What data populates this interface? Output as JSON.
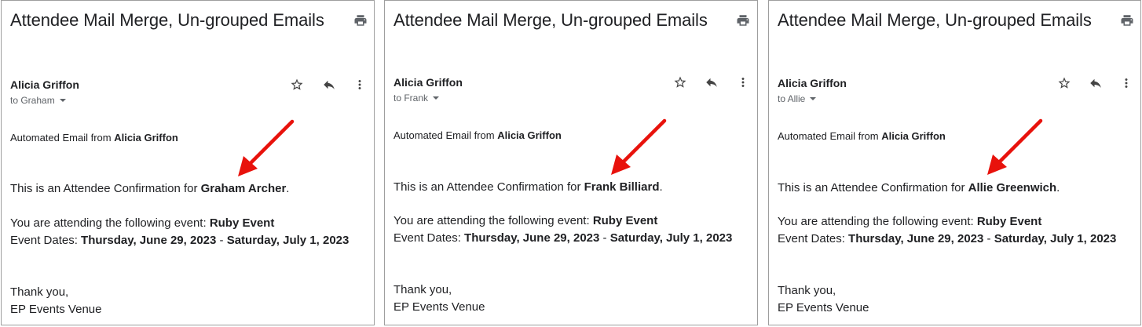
{
  "emails": [
    {
      "subject": "Attendee Mail Merge, Un-grouped Emails",
      "sender": "Alicia Griffon",
      "recipient": "to Graham",
      "automated_prefix": "Automated Email from ",
      "automated_name": "Alicia Griffon",
      "confirmation_prefix": "This is an Attendee Confirmation for ",
      "attendee_name": "Graham Archer",
      "confirmation_suffix": ".",
      "event_prefix": "You are attending the following event: ",
      "event_name": "Ruby Event",
      "dates_prefix": "Event Dates: ",
      "date_start": "Thursday, June 29, 2023",
      "date_sep": " - ",
      "date_end": "Saturday, July 1, 2023",
      "thanks": "Thank you,",
      "venue": "EP Events Venue"
    },
    {
      "subject": "Attendee Mail Merge, Un-grouped Emails",
      "sender": "Alicia Griffon",
      "recipient": "to Frank",
      "automated_prefix": "Automated Email from ",
      "automated_name": "Alicia Griffon",
      "confirmation_prefix": "This is an Attendee Confirmation for ",
      "attendee_name": "Frank Billiard",
      "confirmation_suffix": ".",
      "event_prefix": "You are attending the following event: ",
      "event_name": "Ruby Event",
      "dates_prefix": "Event Dates: ",
      "date_start": "Thursday, June 29, 2023",
      "date_sep": " - ",
      "date_end": "Saturday, July 1, 2023",
      "thanks": "Thank you,",
      "venue": "EP Events Venue"
    },
    {
      "subject": "Attendee Mail Merge, Un-grouped Emails",
      "sender": "Alicia Griffon",
      "recipient": "to Allie",
      "automated_prefix": "Automated Email from ",
      "automated_name": "Alicia Griffon",
      "confirmation_prefix": "This is an Attendee Confirmation for ",
      "attendee_name": "Allie Greenwich",
      "confirmation_suffix": ".",
      "event_prefix": "You are attending the following event: ",
      "event_name": "Ruby Event",
      "dates_prefix": "Event Dates: ",
      "date_start": "Thursday, June 29, 2023",
      "date_sep": " - ",
      "date_end": "Saturday, July 1, 2023",
      "thanks": "Thank you,",
      "venue": "EP Events Venue"
    }
  ],
  "icons": {
    "print": "print-icon",
    "star": "star-icon",
    "reply": "reply-icon",
    "more": "more-vert-icon",
    "caret": "caret-down-icon"
  },
  "colors": {
    "arrow": "#e8120c",
    "text": "#202124",
    "muted": "#5f6368",
    "border": "#9e9e9e"
  }
}
